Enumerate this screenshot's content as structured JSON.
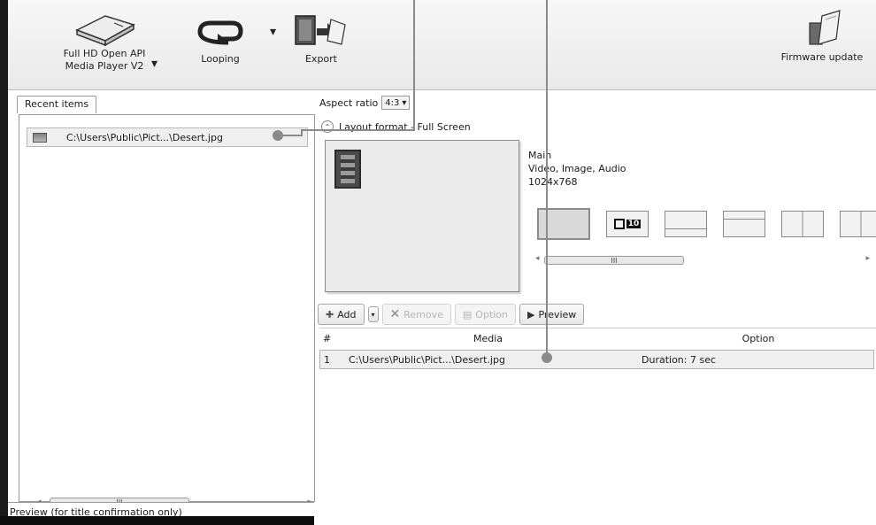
{
  "toolbar": {
    "device_label": "Full HD Open API\nMedia Player V2",
    "looping_label": "Looping",
    "export_label": "Export",
    "firmware_label": "Firmware update"
  },
  "left": {
    "tab_label": "Recent items",
    "recent_items": [
      "C:\\Users\\Public\\Pict...\\Desert.jpg"
    ],
    "preview_label": "Preview (for title confirmation only)"
  },
  "right": {
    "aspect_label": "Aspect ratio",
    "aspect_value": "4:3",
    "layout_format": "Layout format - Full Screen",
    "zone_name": "Main",
    "zone_types": "Video, Image, Audio",
    "zone_resolution": "1024x768",
    "layout_ten_label": "10"
  },
  "media_toolbar": {
    "add": "Add",
    "remove": "Remove",
    "option": "Option",
    "preview": "Preview"
  },
  "media_table": {
    "headers": [
      "#",
      "Media",
      "Option"
    ],
    "rows": [
      {
        "num": "1",
        "media": "C:\\Users\\Public\\Pict...\\Desert.jpg",
        "option": "Duration: 7 sec"
      }
    ]
  },
  "scrollbar_label": "III"
}
